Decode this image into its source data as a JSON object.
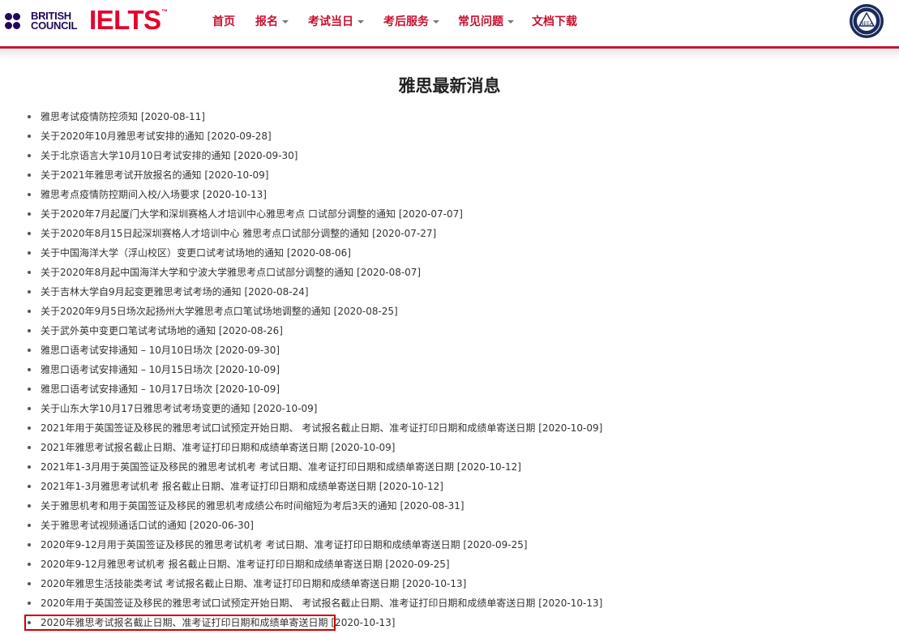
{
  "header": {
    "brand_line1": "BRITISH",
    "brand_line2": "COUNCIL",
    "product": "IELTS",
    "product_mark": "™",
    "nav": [
      {
        "label": "首页",
        "dropdown": false
      },
      {
        "label": "报名",
        "dropdown": true
      },
      {
        "label": "考试当日",
        "dropdown": true
      },
      {
        "label": "考后服务",
        "dropdown": true
      },
      {
        "label": "常见问题",
        "dropdown": true
      },
      {
        "label": "文档下载",
        "dropdown": false
      }
    ],
    "seal_text": "NEEA",
    "accent_color": "#c8102e"
  },
  "main": {
    "title": "雅思最新消息",
    "news": [
      {
        "title": "雅思考试疫情防控须知",
        "date": "[2020-08-11]"
      },
      {
        "title": "关于2020年10月雅思考试安排的通知",
        "date": "[2020-09-28]"
      },
      {
        "title": "关于北京语言大学10月10日考试安排的通知",
        "date": "[2020-09-30]"
      },
      {
        "title": "关于2021年雅思考试开放报名的通知",
        "date": "[2020-10-09]"
      },
      {
        "title": "雅思考点疫情防控期间入校/入场要求",
        "date": "[2020-10-13]"
      },
      {
        "title": "关于2020年7月起厦门大学和深圳赛格人才培训中心雅思考点 口试部分调整的通知",
        "date": "[2020-07-07]"
      },
      {
        "title": "关于2020年8月15日起深圳赛格人才培训中心 雅思考点口试部分调整的通知",
        "date": "[2020-07-27]"
      },
      {
        "title": "关于中国海洋大学（浮山校区）变更口试考试场地的通知",
        "date": "[2020-08-06]"
      },
      {
        "title": "关于2020年8月起中国海洋大学和宁波大学雅思考点口试部分调整的通知",
        "date": "[2020-08-07]"
      },
      {
        "title": "关于吉林大学自9月起变更雅思考试考场的通知",
        "date": "[2020-08-24]"
      },
      {
        "title": "关于2020年9月5日场次起扬州大学雅思考点口笔试场地调整的通知",
        "date": "[2020-08-25]"
      },
      {
        "title": "关于武外英中变更口笔试考试场地的通知",
        "date": "[2020-08-26]"
      },
      {
        "title": "雅思口语考试安排通知 – 10月10日场次",
        "date": "[2020-09-30]"
      },
      {
        "title": "雅思口语考试安排通知 – 10月15日场次",
        "date": "[2020-10-09]"
      },
      {
        "title": "雅思口语考试安排通知 – 10月17日场次",
        "date": "[2020-10-09]"
      },
      {
        "title": "关于山东大学10月17日雅思考试考场变更的通知",
        "date": "[2020-10-09]"
      },
      {
        "title": "2021年用于英国签证及移民的雅思考试口试预定开始日期、 考试报名截止日期、准考证打印日期和成绩单寄送日期",
        "date": "[2020-10-09]"
      },
      {
        "title": "2021年雅思考试报名截止日期、准考证打印日期和成绩单寄送日期",
        "date": "[2020-10-09]"
      },
      {
        "title": "2021年1-3月用于英国签证及移民的雅思考试机考 考试日期、准考证打印日期和成绩单寄送日期",
        "date": "[2020-10-12]"
      },
      {
        "title": "2021年1-3月雅思考试机考 报名截止日期、准考证打印日期和成绩单寄送日期",
        "date": "[2020-10-12]"
      },
      {
        "title": "关于雅思机考和用于英国签证及移民的雅思机考成绩公布时间缩短为考后3天的通知",
        "date": "[2020-08-31]"
      },
      {
        "title": "关于雅思考试视频通话口试的通知",
        "date": "[2020-06-30]"
      },
      {
        "title": "2020年9-12月用于英国签证及移民的雅思考试机考 考试日期、准考证打印日期和成绩单寄送日期",
        "date": "[2020-09-25]"
      },
      {
        "title": "2020年9-12月雅思考试机考 报名截止日期、准考证打印日期和成绩单寄送日期",
        "date": "[2020-09-25]"
      },
      {
        "title": "2020年雅思生活技能类考试 考试报名截止日期、准考证打印日期和成绩单寄送日期",
        "date": "[2020-10-13]"
      },
      {
        "title": "2020年用于英国签证及移民的雅思考试口试预定开始日期、 考试报名截止日期、准考证打印日期和成绩单寄送日期",
        "date": "[2020-10-13]"
      },
      {
        "title": "2020年雅思考试报名截止日期、准考证打印日期和成绩单寄送日期",
        "date": "[2020-10-13]"
      }
    ]
  }
}
